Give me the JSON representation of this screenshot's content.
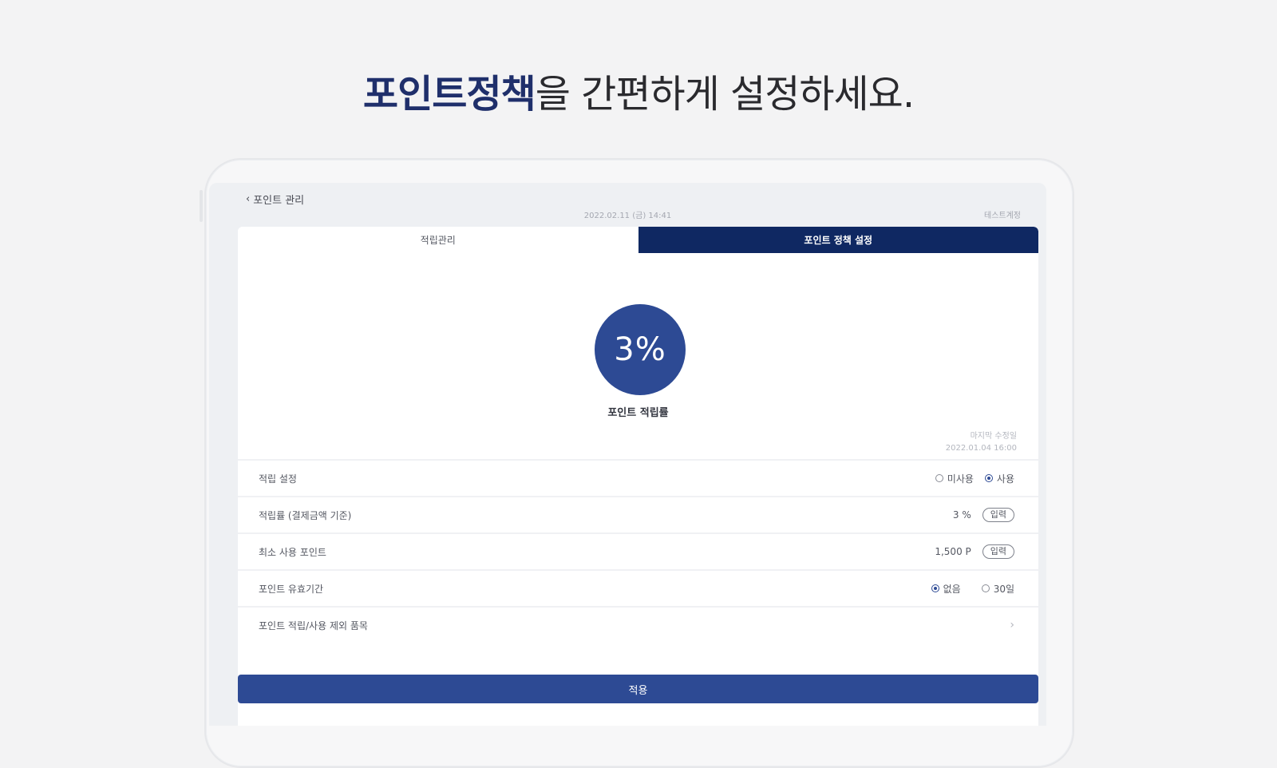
{
  "headline": {
    "accent": "포인트정책",
    "rest": "을 간편하게 설정하세요."
  },
  "topbar": {
    "back_label": "포인트 관리",
    "datetime": "2022.02.11 (금) 14:41",
    "account": "테스트계정"
  },
  "tabs": [
    {
      "label": "적립관리",
      "active": false
    },
    {
      "label": "포인트 정책 설정",
      "active": true
    }
  ],
  "rate": {
    "value": "3%",
    "label": "포인트 적립률"
  },
  "modified": {
    "label": "마지막 수정일",
    "date": "2022.01.04 16:00"
  },
  "rows": {
    "accrual": {
      "label": "적립 설정",
      "options": [
        {
          "label": "미사용",
          "selected": false
        },
        {
          "label": "사용",
          "selected": true
        }
      ]
    },
    "rate": {
      "label": "적립률 (결제금액 기준)",
      "value": "3 %",
      "button": "입력"
    },
    "min_use": {
      "label": "최소 사용 포인트",
      "value": "1,500 P",
      "button": "입력"
    },
    "expiry": {
      "label": "포인트 유효기간",
      "options": [
        {
          "label": "없음",
          "selected": true
        },
        {
          "label": "30일",
          "selected": false
        }
      ]
    },
    "exclude": {
      "label": "포인트 적립/사용 제외 품목"
    }
  },
  "save_label": "적용"
}
